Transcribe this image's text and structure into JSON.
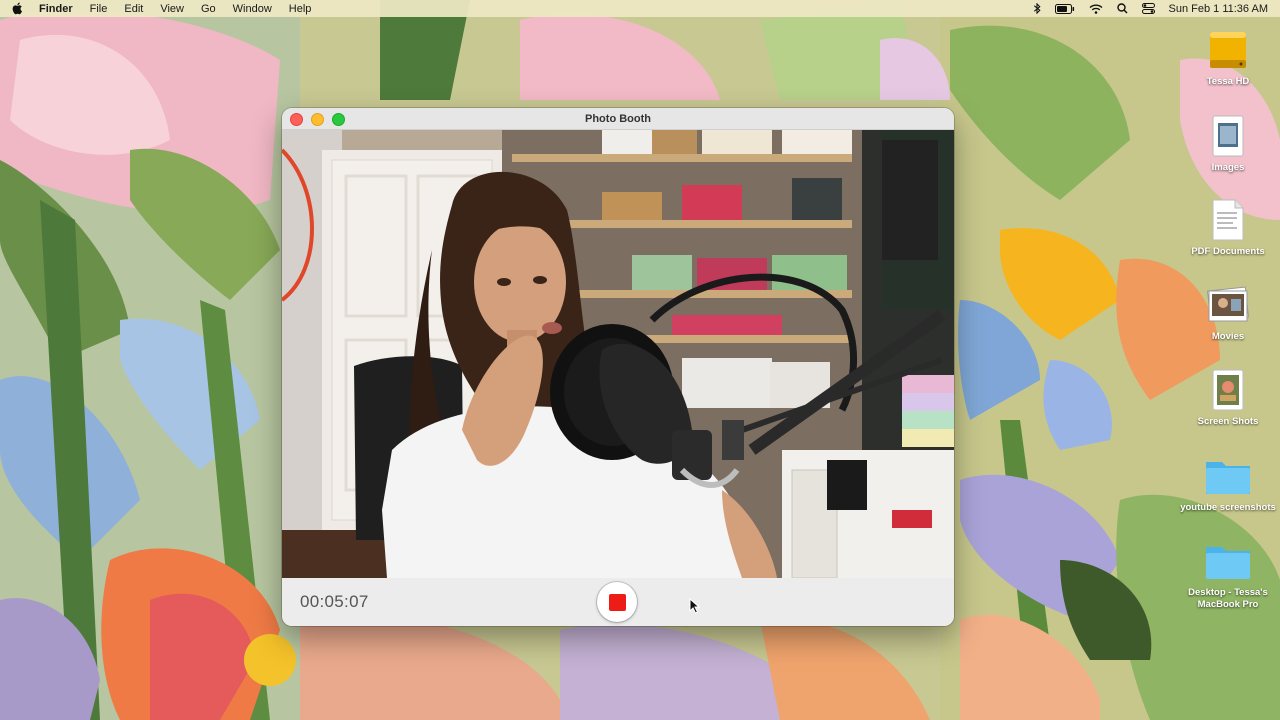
{
  "menubar": {
    "app_name": "Finder",
    "menus": [
      "File",
      "Edit",
      "View",
      "Go",
      "Window",
      "Help"
    ],
    "clock": "Sun Feb 1  11:36 AM",
    "status_icons": [
      "bluetooth-icon",
      "battery-icon",
      "wifi-icon",
      "search-icon",
      "control-center-icon"
    ]
  },
  "desktop": {
    "icons": [
      {
        "label": "Tessa HD",
        "icon": "hard-drive-icon"
      },
      {
        "label": "Images",
        "icon": "image-file-icon"
      },
      {
        "label": "PDF Documents",
        "icon": "pdf-file-icon"
      },
      {
        "label": "Movies",
        "icon": "photo-stack-icon"
      },
      {
        "label": "Screen Shots",
        "icon": "screenshot-file-icon"
      },
      {
        "label": "youtube screenshots",
        "icon": "folder-icon"
      },
      {
        "label": "Desktop - Tessa's MacBook Pro",
        "icon": "folder-icon"
      }
    ]
  },
  "window": {
    "title": "Photo Booth",
    "timer": "00:05:07",
    "record_state": "recording",
    "accent_color": "#ee1c16"
  }
}
